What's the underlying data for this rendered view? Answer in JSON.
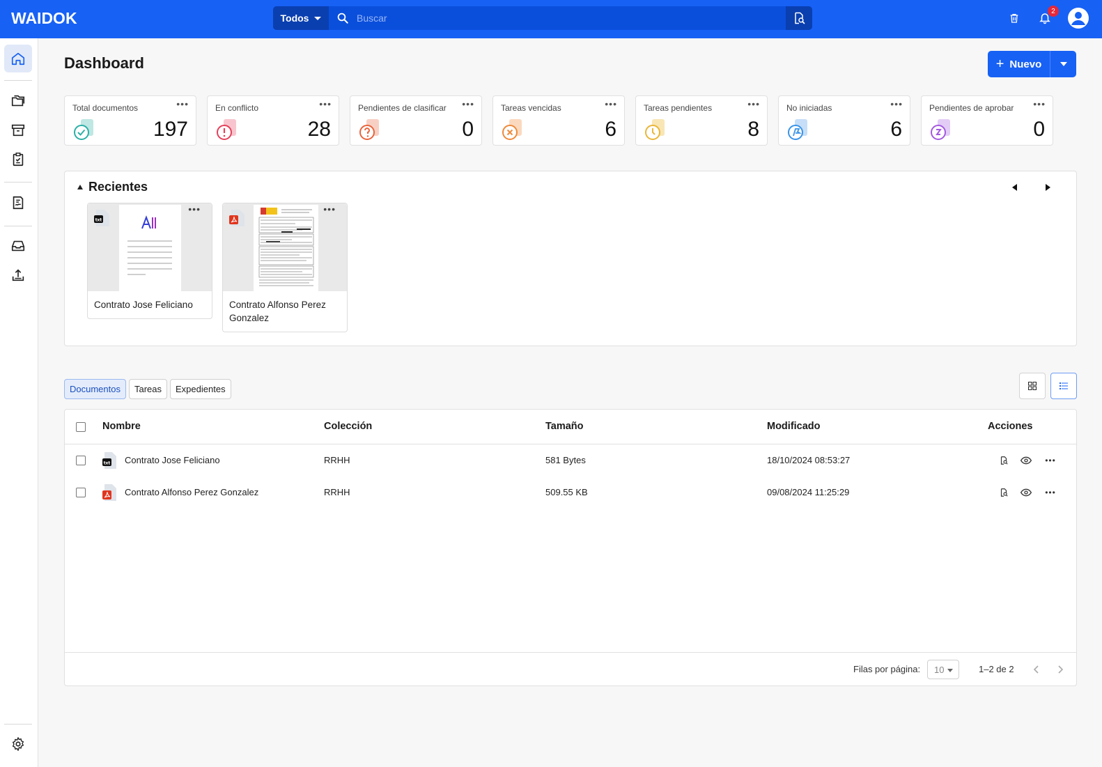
{
  "app": {
    "logo": "WAIDOK"
  },
  "search": {
    "scope": "Todos",
    "placeholder": "Buscar"
  },
  "notifications": {
    "count": "2"
  },
  "page": {
    "title": "Dashboard"
  },
  "new_button": {
    "label": "Nuevo"
  },
  "stats": [
    {
      "label": "Total documentos",
      "value": "197",
      "color": "#2bb0a6",
      "icon": "check-icon"
    },
    {
      "label": "En conflicto",
      "value": "28",
      "color": "#e5405a",
      "icon": "exclamation-icon"
    },
    {
      "label": "Pendientes de clasificar",
      "value": "0",
      "color": "#e8643c",
      "icon": "question-icon"
    },
    {
      "label": "Tareas vencidas",
      "value": "6",
      "color": "#ee8a3a",
      "icon": "x-icon"
    },
    {
      "label": "Tareas pendientes",
      "value": "8",
      "color": "#e9b638",
      "icon": "clock-icon"
    },
    {
      "label": "No iniciadas",
      "value": "6",
      "color": "#3a94e8",
      "icon": "flag-icon"
    },
    {
      "label": "Pendientes de aprobar",
      "value": "0",
      "color": "#a45ae0",
      "icon": "approval-icon"
    }
  ],
  "recientes": {
    "title": "Recientes",
    "cards": [
      {
        "name": "Contrato Jose Feliciano",
        "type": "txt"
      },
      {
        "name": "Contrato Alfonso Perez Gonzalez",
        "type": "pdf"
      }
    ]
  },
  "tabs": [
    "Documentos",
    "Tareas",
    "Expedientes"
  ],
  "table": {
    "headers": {
      "name": "Nombre",
      "collection": "Colección",
      "size": "Tamaño",
      "modified": "Modificado",
      "actions": "Acciones"
    },
    "rows": [
      {
        "name": "Contrato Jose Feliciano",
        "collection": "RRHH",
        "size": "581 Bytes",
        "modified": "18/10/2024 08:53:27",
        "type": "txt"
      },
      {
        "name": "Contrato Alfonso Perez Gonzalez",
        "collection": "RRHH",
        "size": "509.55 KB",
        "modified": "09/08/2024 11:25:29",
        "type": "pdf"
      }
    ]
  },
  "pagination": {
    "rows_label": "Filas por página:",
    "rows_value": "10",
    "range": "1–2 de 2"
  }
}
